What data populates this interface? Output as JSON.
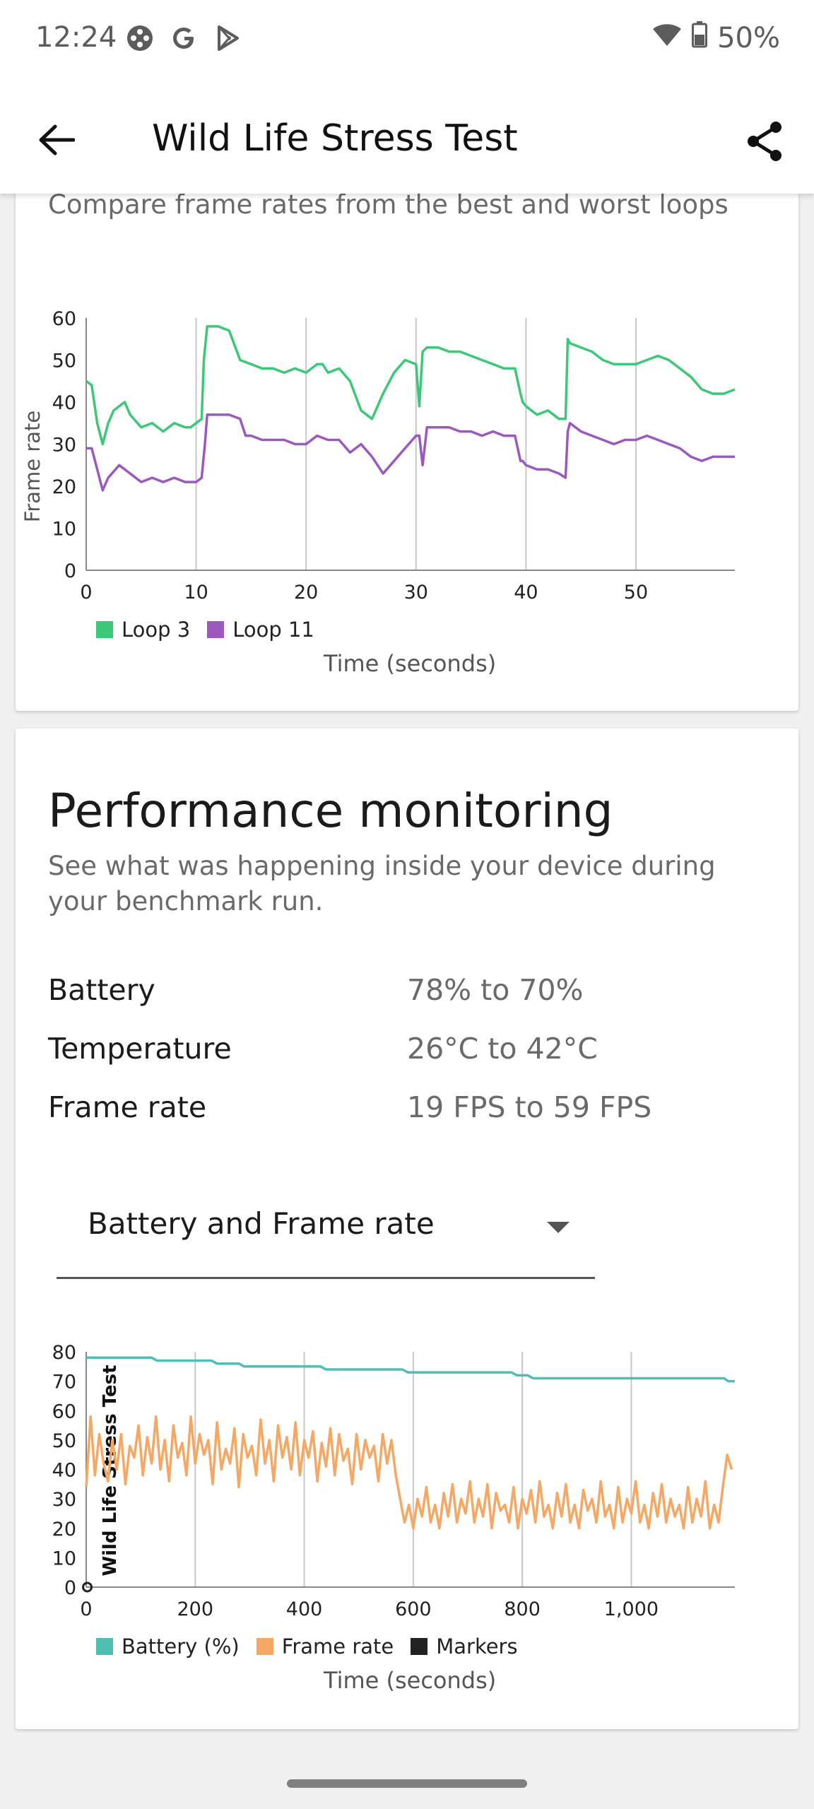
{
  "status_bar": {
    "time": "12:24",
    "battery": "50%",
    "icons": [
      "game-controller-icon",
      "google-icon",
      "play-store-icon",
      "wifi-icon",
      "battery-icon"
    ]
  },
  "app_bar": {
    "title": "Wild Life Stress Test",
    "back_icon": "arrow-left-icon",
    "share_icon": "share-icon"
  },
  "frame_rate_card": {
    "subtitle": "Compare frame rates from the best and worst loops"
  },
  "performance": {
    "title": "Performance monitoring",
    "description": "See what was happening inside your device during your benchmark run.",
    "stats": [
      {
        "label": "Battery",
        "value": "78% to 70%"
      },
      {
        "label": "Temperature",
        "value": "26°C to 42°C"
      },
      {
        "label": "Frame rate",
        "value": "19 FPS to 59 FPS"
      }
    ],
    "dropdown": {
      "value": "Battery and Frame rate"
    }
  },
  "chart_data": [
    {
      "type": "line",
      "xlabel": "Time (seconds)",
      "ylabel": "Frame rate",
      "xlim": [
        0,
        59
      ],
      "ylim": [
        0,
        60
      ],
      "xticks": [
        "0",
        "10",
        "20",
        "30",
        "40",
        "50"
      ],
      "yticks": [
        "0",
        "10",
        "20",
        "30",
        "40",
        "50",
        "60"
      ],
      "grid": "vertical",
      "legend": "bottom-left",
      "series": [
        {
          "name": "Loop 3",
          "color": "#3cc878",
          "x": [
            0,
            0.5,
            1,
            1.5,
            2,
            2.5,
            3,
            3.5,
            4,
            5,
            6,
            7,
            8,
            9,
            9.5,
            10,
            10.5,
            10.7,
            11,
            12,
            13,
            14,
            15,
            16,
            17,
            18,
            19,
            20,
            21,
            21.5,
            22,
            23,
            24,
            25,
            26,
            27,
            28,
            29,
            30,
            30.3,
            30.6,
            31,
            32,
            33,
            34,
            35,
            36,
            37,
            38,
            39,
            39.5,
            39.7,
            40,
            41,
            42,
            43,
            43.6,
            43.8,
            44,
            45,
            46,
            47,
            48,
            49,
            50,
            51,
            52,
            53,
            54,
            55,
            56,
            57,
            58,
            59
          ],
          "y": [
            45,
            44,
            35,
            30,
            35,
            38,
            39,
            40,
            37,
            34,
            35,
            33,
            35,
            34,
            34,
            35,
            36,
            50,
            58,
            58,
            57,
            50,
            49,
            48,
            48,
            47,
            48,
            47,
            49,
            49,
            47,
            48,
            45,
            38,
            36,
            42,
            47,
            50,
            49,
            39,
            52,
            53,
            53,
            52,
            52,
            51,
            50,
            49,
            48,
            48,
            42,
            40,
            39,
            37,
            38,
            36,
            36,
            55,
            54,
            53,
            52,
            50,
            49,
            49,
            49,
            50,
            51,
            50,
            48,
            46,
            43,
            42,
            42,
            43
          ]
        },
        {
          "name": "Loop 11",
          "color": "#9b59c0",
          "x": [
            0,
            0.5,
            1,
            1.5,
            2,
            3,
            4,
            5,
            6,
            7,
            8,
            9,
            10,
            10.5,
            10.8,
            11,
            12,
            13,
            14,
            14.5,
            15,
            16,
            17,
            18,
            19,
            20,
            21,
            22,
            23,
            24,
            25,
            26,
            27,
            28,
            29,
            30,
            30.3,
            30.6,
            31,
            32,
            33,
            34,
            35,
            36,
            37,
            38,
            39,
            39.5,
            39.7,
            40,
            41,
            42,
            43,
            43.6,
            43.8,
            44,
            45,
            46,
            47,
            48,
            49,
            50,
            51,
            52,
            53,
            54,
            55,
            56,
            57,
            58,
            59
          ],
          "y": [
            29,
            29,
            24,
            19,
            22,
            25,
            23,
            21,
            22,
            21,
            22,
            21,
            21,
            22,
            30,
            37,
            37,
            37,
            36,
            32,
            32,
            31,
            31,
            31,
            30,
            30,
            32,
            31,
            31,
            28,
            30,
            27,
            23,
            26,
            29,
            32,
            32,
            25,
            34,
            34,
            34,
            33,
            33,
            32,
            33,
            32,
            32,
            26,
            26,
            25,
            24,
            24,
            23,
            22,
            33,
            35,
            33,
            32,
            31,
            30,
            31,
            31,
            32,
            31,
            30,
            29,
            27,
            26,
            27,
            27,
            27
          ]
        }
      ]
    },
    {
      "type": "line",
      "xlabel": "Time (seconds)",
      "ylabel": "Wild Life Stress Test",
      "xlim": [
        0,
        1190
      ],
      "ylim": [
        0,
        80
      ],
      "xticks": [
        "0",
        "200",
        "400",
        "600",
        "800",
        "1,000"
      ],
      "yticks": [
        "0",
        "10",
        "20",
        "30",
        "40",
        "50",
        "60",
        "70",
        "80"
      ],
      "grid": "vertical",
      "legend": "bottom-left",
      "series": [
        {
          "name": "Battery (%)",
          "color": "#4fbfb4",
          "x": [
            0,
            120,
            130,
            230,
            240,
            280,
            290,
            430,
            440,
            580,
            590,
            780,
            790,
            810,
            820,
            1170,
            1178,
            1190
          ],
          "y": [
            78,
            78,
            77,
            77,
            76,
            76,
            75,
            75,
            74,
            74,
            73,
            73,
            72,
            72,
            71,
            71,
            70,
            70
          ]
        },
        {
          "name": "Frame rate",
          "color": "#f5a863",
          "x": [
            0,
            8,
            16,
            24,
            32,
            40,
            48,
            56,
            64,
            72,
            80,
            88,
            96,
            104,
            112,
            120,
            128,
            136,
            144,
            152,
            160,
            168,
            176,
            184,
            192,
            200,
            208,
            216,
            224,
            232,
            240,
            248,
            256,
            264,
            272,
            280,
            288,
            296,
            304,
            312,
            320,
            328,
            336,
            344,
            352,
            360,
            368,
            376,
            384,
            392,
            400,
            408,
            416,
            424,
            432,
            440,
            448,
            456,
            464,
            472,
            480,
            488,
            496,
            504,
            512,
            520,
            528,
            536,
            544,
            552,
            560,
            568,
            576,
            584,
            592,
            600,
            608,
            616,
            624,
            632,
            640,
            648,
            656,
            664,
            672,
            680,
            688,
            696,
            704,
            712,
            720,
            728,
            736,
            744,
            752,
            760,
            768,
            776,
            784,
            792,
            800,
            808,
            816,
            824,
            832,
            840,
            848,
            856,
            864,
            872,
            880,
            888,
            896,
            904,
            912,
            920,
            928,
            936,
            944,
            952,
            960,
            968,
            976,
            984,
            992,
            1000,
            1008,
            1016,
            1024,
            1032,
            1040,
            1048,
            1056,
            1064,
            1072,
            1080,
            1088,
            1096,
            1104,
            1112,
            1120,
            1128,
            1136,
            1144,
            1152,
            1160,
            1168,
            1176,
            1184
          ],
          "y": [
            34,
            58,
            38,
            52,
            42,
            36,
            50,
            40,
            52,
            35,
            48,
            44,
            55,
            38,
            51,
            42,
            58,
            40,
            50,
            36,
            55,
            44,
            49,
            38,
            58,
            42,
            52,
            45,
            50,
            35,
            56,
            40,
            47,
            42,
            54,
            34,
            52,
            44,
            48,
            38,
            57,
            42,
            50,
            36,
            55,
            44,
            51,
            40,
            56,
            38,
            50,
            44,
            53,
            36,
            49,
            41,
            54,
            38,
            52,
            43,
            47,
            35,
            52,
            40,
            50,
            44,
            48,
            36,
            52,
            42,
            50,
            38,
            30,
            22,
            28,
            20,
            30,
            24,
            34,
            22,
            28,
            20,
            32,
            24,
            35,
            22,
            30,
            25,
            36,
            22,
            30,
            24,
            35,
            20,
            32,
            26,
            28,
            22,
            34,
            20,
            30,
            25,
            33,
            22,
            36,
            24,
            28,
            20,
            32,
            24,
            35,
            22,
            28,
            20,
            33,
            26,
            30,
            22,
            36,
            24,
            28,
            20,
            34,
            22,
            30,
            25,
            36,
            22,
            28,
            20,
            32,
            24,
            35,
            22,
            30,
            24,
            28,
            20,
            34,
            22,
            30,
            24,
            36,
            20,
            28,
            22,
            34,
            45,
            40
          ]
        },
        {
          "name": "Markers",
          "color": "#222222",
          "x": [
            2
          ],
          "y": [
            0
          ]
        }
      ]
    }
  ]
}
